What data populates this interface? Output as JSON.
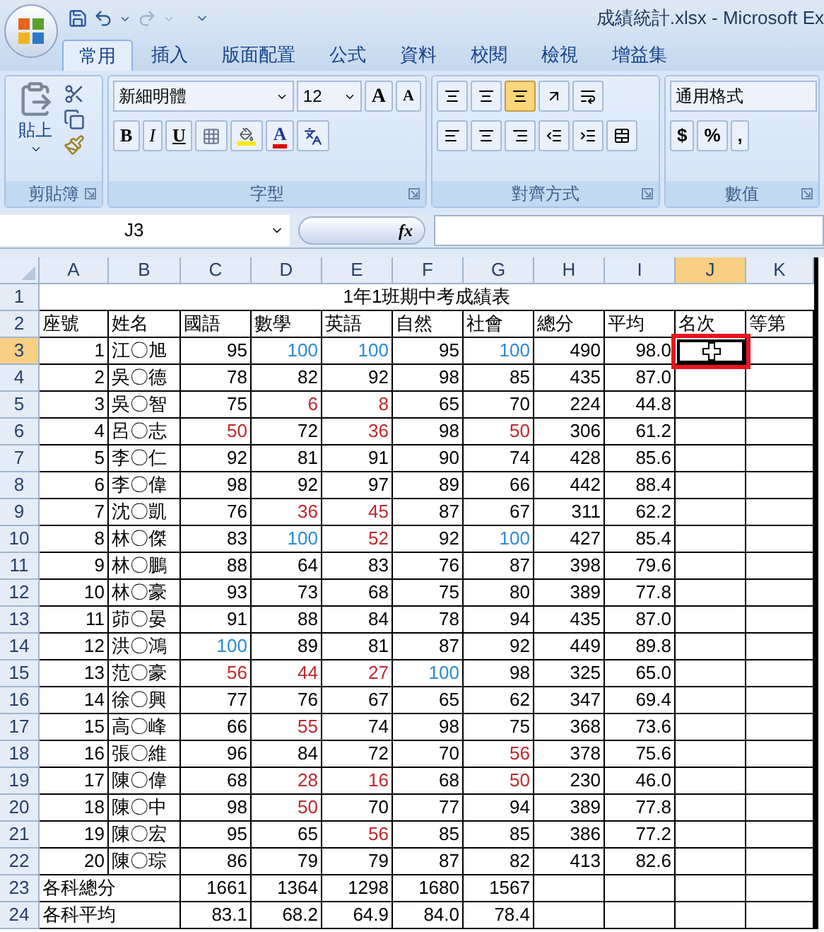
{
  "window": {
    "title": "成績統計.xlsx - Microsoft Ex"
  },
  "tabs": [
    {
      "label": "常用",
      "selected": true
    },
    {
      "label": "插入",
      "selected": false
    },
    {
      "label": "版面配置",
      "selected": false
    },
    {
      "label": "公式",
      "selected": false
    },
    {
      "label": "資料",
      "selected": false
    },
    {
      "label": "校閱",
      "selected": false
    },
    {
      "label": "檢視",
      "selected": false
    },
    {
      "label": "增益集",
      "selected": false
    }
  ],
  "ribbon": {
    "clipboard": {
      "label": "剪貼簿",
      "paste": "貼上"
    },
    "font": {
      "label": "字型",
      "font_name": "新細明體",
      "font_size": "12",
      "grow": "A",
      "shrink": "A",
      "bold": "B",
      "italic": "I",
      "underline": "U",
      "font_color": "A"
    },
    "alignment": {
      "label": "對齊方式",
      "bottom_align_selected": true
    },
    "number": {
      "label": "數值",
      "format": "通用格式",
      "currency": "$",
      "percent": "%",
      "comma": ","
    }
  },
  "formula_bar": {
    "name_box": "J3",
    "function_label": "fx"
  },
  "columns": [
    {
      "label": "A",
      "selected": false
    },
    {
      "label": "B",
      "selected": false
    },
    {
      "label": "C",
      "selected": false
    },
    {
      "label": "D",
      "selected": false
    },
    {
      "label": "E",
      "selected": false
    },
    {
      "label": "F",
      "selected": false
    },
    {
      "label": "G",
      "selected": false
    },
    {
      "label": "H",
      "selected": false
    },
    {
      "label": "I",
      "selected": false
    },
    {
      "label": "J",
      "selected": true
    },
    {
      "label": "K",
      "selected": false
    }
  ],
  "title_row": {
    "row": "1",
    "text": "1年1班期中考成績表",
    "selected": false
  },
  "header_row": {
    "row": "2",
    "labels": [
      "座號",
      "姓名",
      "國語",
      "數學",
      "英語",
      "自然",
      "社會",
      "總分",
      "平均",
      "名次",
      "等第"
    ],
    "selected": false
  },
  "students": [
    {
      "row": "3",
      "seat": "1",
      "name": "江〇旭",
      "scores": [
        {
          "text": "95",
          "color": "#000000"
        },
        {
          "text": "100",
          "color": "#2e8bd8"
        },
        {
          "text": "100",
          "color": "#2e8bd8"
        },
        {
          "text": "95",
          "color": "#000000"
        },
        {
          "text": "100",
          "color": "#2e8bd8"
        }
      ],
      "total": "490",
      "average": "98.0",
      "selected": true
    },
    {
      "row": "4",
      "seat": "2",
      "name": "吳〇德",
      "scores": [
        {
          "text": "78",
          "color": "#000000"
        },
        {
          "text": "82",
          "color": "#000000"
        },
        {
          "text": "92",
          "color": "#000000"
        },
        {
          "text": "98",
          "color": "#000000"
        },
        {
          "text": "85",
          "color": "#000000"
        }
      ],
      "total": "435",
      "average": "87.0",
      "selected": false
    },
    {
      "row": "5",
      "seat": "3",
      "name": "吳〇智",
      "scores": [
        {
          "text": "75",
          "color": "#000000"
        },
        {
          "text": "6",
          "color": "#c0282e"
        },
        {
          "text": "8",
          "color": "#c0282e"
        },
        {
          "text": "65",
          "color": "#000000"
        },
        {
          "text": "70",
          "color": "#000000"
        }
      ],
      "total": "224",
      "average": "44.8",
      "selected": false
    },
    {
      "row": "6",
      "seat": "4",
      "name": "呂〇志",
      "scores": [
        {
          "text": "50",
          "color": "#c0282e"
        },
        {
          "text": "72",
          "color": "#000000"
        },
        {
          "text": "36",
          "color": "#c0282e"
        },
        {
          "text": "98",
          "color": "#000000"
        },
        {
          "text": "50",
          "color": "#c0282e"
        }
      ],
      "total": "306",
      "average": "61.2",
      "selected": false
    },
    {
      "row": "7",
      "seat": "5",
      "name": "李〇仁",
      "scores": [
        {
          "text": "92",
          "color": "#000000"
        },
        {
          "text": "81",
          "color": "#000000"
        },
        {
          "text": "91",
          "color": "#000000"
        },
        {
          "text": "90",
          "color": "#000000"
        },
        {
          "text": "74",
          "color": "#000000"
        }
      ],
      "total": "428",
      "average": "85.6",
      "selected": false
    },
    {
      "row": "8",
      "seat": "6",
      "name": "李〇偉",
      "scores": [
        {
          "text": "98",
          "color": "#000000"
        },
        {
          "text": "92",
          "color": "#000000"
        },
        {
          "text": "97",
          "color": "#000000"
        },
        {
          "text": "89",
          "color": "#000000"
        },
        {
          "text": "66",
          "color": "#000000"
        }
      ],
      "total": "442",
      "average": "88.4",
      "selected": false
    },
    {
      "row": "9",
      "seat": "7",
      "name": "沈〇凱",
      "scores": [
        {
          "text": "76",
          "color": "#000000"
        },
        {
          "text": "36",
          "color": "#c0282e"
        },
        {
          "text": "45",
          "color": "#c0282e"
        },
        {
          "text": "87",
          "color": "#000000"
        },
        {
          "text": "67",
          "color": "#000000"
        }
      ],
      "total": "311",
      "average": "62.2",
      "selected": false
    },
    {
      "row": "10",
      "seat": "8",
      "name": "林〇傑",
      "scores": [
        {
          "text": "83",
          "color": "#000000"
        },
        {
          "text": "100",
          "color": "#2e8bd8"
        },
        {
          "text": "52",
          "color": "#c0282e"
        },
        {
          "text": "92",
          "color": "#000000"
        },
        {
          "text": "100",
          "color": "#2e8bd8"
        }
      ],
      "total": "427",
      "average": "85.4",
      "selected": false
    },
    {
      "row": "11",
      "seat": "9",
      "name": "林〇鵬",
      "scores": [
        {
          "text": "88",
          "color": "#000000"
        },
        {
          "text": "64",
          "color": "#000000"
        },
        {
          "text": "83",
          "color": "#000000"
        },
        {
          "text": "76",
          "color": "#000000"
        },
        {
          "text": "87",
          "color": "#000000"
        }
      ],
      "total": "398",
      "average": "79.6",
      "selected": false
    },
    {
      "row": "12",
      "seat": "10",
      "name": "林〇豪",
      "scores": [
        {
          "text": "93",
          "color": "#000000"
        },
        {
          "text": "73",
          "color": "#000000"
        },
        {
          "text": "68",
          "color": "#000000"
        },
        {
          "text": "75",
          "color": "#000000"
        },
        {
          "text": "80",
          "color": "#000000"
        }
      ],
      "total": "389",
      "average": "77.8",
      "selected": false
    },
    {
      "row": "13",
      "seat": "11",
      "name": "茆〇晏",
      "scores": [
        {
          "text": "91",
          "color": "#000000"
        },
        {
          "text": "88",
          "color": "#000000"
        },
        {
          "text": "84",
          "color": "#000000"
        },
        {
          "text": "78",
          "color": "#000000"
        },
        {
          "text": "94",
          "color": "#000000"
        }
      ],
      "total": "435",
      "average": "87.0",
      "selected": false
    },
    {
      "row": "14",
      "seat": "12",
      "name": "洪〇鴻",
      "scores": [
        {
          "text": "100",
          "color": "#2e8bd8"
        },
        {
          "text": "89",
          "color": "#000000"
        },
        {
          "text": "81",
          "color": "#000000"
        },
        {
          "text": "87",
          "color": "#000000"
        },
        {
          "text": "92",
          "color": "#000000"
        }
      ],
      "total": "449",
      "average": "89.8",
      "selected": false
    },
    {
      "row": "15",
      "seat": "13",
      "name": "范〇豪",
      "scores": [
        {
          "text": "56",
          "color": "#c0282e"
        },
        {
          "text": "44",
          "color": "#c0282e"
        },
        {
          "text": "27",
          "color": "#c0282e"
        },
        {
          "text": "100",
          "color": "#2e8bd8"
        },
        {
          "text": "98",
          "color": "#000000"
        }
      ],
      "total": "325",
      "average": "65.0",
      "selected": false
    },
    {
      "row": "16",
      "seat": "14",
      "name": "徐〇興",
      "scores": [
        {
          "text": "77",
          "color": "#000000"
        },
        {
          "text": "76",
          "color": "#000000"
        },
        {
          "text": "67",
          "color": "#000000"
        },
        {
          "text": "65",
          "color": "#000000"
        },
        {
          "text": "62",
          "color": "#000000"
        }
      ],
      "total": "347",
      "average": "69.4",
      "selected": false
    },
    {
      "row": "17",
      "seat": "15",
      "name": "高〇峰",
      "scores": [
        {
          "text": "66",
          "color": "#000000"
        },
        {
          "text": "55",
          "color": "#c0282e"
        },
        {
          "text": "74",
          "color": "#000000"
        },
        {
          "text": "98",
          "color": "#000000"
        },
        {
          "text": "75",
          "color": "#000000"
        }
      ],
      "total": "368",
      "average": "73.6",
      "selected": false
    },
    {
      "row": "18",
      "seat": "16",
      "name": "張〇維",
      "scores": [
        {
          "text": "96",
          "color": "#000000"
        },
        {
          "text": "84",
          "color": "#000000"
        },
        {
          "text": "72",
          "color": "#000000"
        },
        {
          "text": "70",
          "color": "#000000"
        },
        {
          "text": "56",
          "color": "#c0282e"
        }
      ],
      "total": "378",
      "average": "75.6",
      "selected": false
    },
    {
      "row": "19",
      "seat": "17",
      "name": "陳〇偉",
      "scores": [
        {
          "text": "68",
          "color": "#000000"
        },
        {
          "text": "28",
          "color": "#c0282e"
        },
        {
          "text": "16",
          "color": "#c0282e"
        },
        {
          "text": "68",
          "color": "#000000"
        },
        {
          "text": "50",
          "color": "#c0282e"
        }
      ],
      "total": "230",
      "average": "46.0",
      "selected": false
    },
    {
      "row": "20",
      "seat": "18",
      "name": "陳〇中",
      "scores": [
        {
          "text": "98",
          "color": "#000000"
        },
        {
          "text": "50",
          "color": "#c0282e"
        },
        {
          "text": "70",
          "color": "#000000"
        },
        {
          "text": "77",
          "color": "#000000"
        },
        {
          "text": "94",
          "color": "#000000"
        }
      ],
      "total": "389",
      "average": "77.8",
      "selected": false
    },
    {
      "row": "21",
      "seat": "19",
      "name": "陳〇宏",
      "scores": [
        {
          "text": "95",
          "color": "#000000"
        },
        {
          "text": "65",
          "color": "#000000"
        },
        {
          "text": "56",
          "color": "#c0282e"
        },
        {
          "text": "85",
          "color": "#000000"
        },
        {
          "text": "85",
          "color": "#000000"
        }
      ],
      "total": "386",
      "average": "77.2",
      "selected": false
    },
    {
      "row": "22",
      "seat": "20",
      "name": "陳〇琮",
      "scores": [
        {
          "text": "86",
          "color": "#000000"
        },
        {
          "text": "79",
          "color": "#000000"
        },
        {
          "text": "79",
          "color": "#000000"
        },
        {
          "text": "87",
          "color": "#000000"
        },
        {
          "text": "82",
          "color": "#000000"
        }
      ],
      "total": "413",
      "average": "82.6",
      "selected": false
    }
  ],
  "summary_rows": [
    {
      "row": "23",
      "label": "各科總分",
      "values": [
        "1661",
        "1364",
        "1298",
        "1680",
        "1567"
      ],
      "selected": false
    },
    {
      "row": "24",
      "label": "各科平均",
      "values": [
        "83.1",
        "68.2",
        "64.9",
        "84.0",
        "78.4"
      ],
      "selected": false
    }
  ]
}
